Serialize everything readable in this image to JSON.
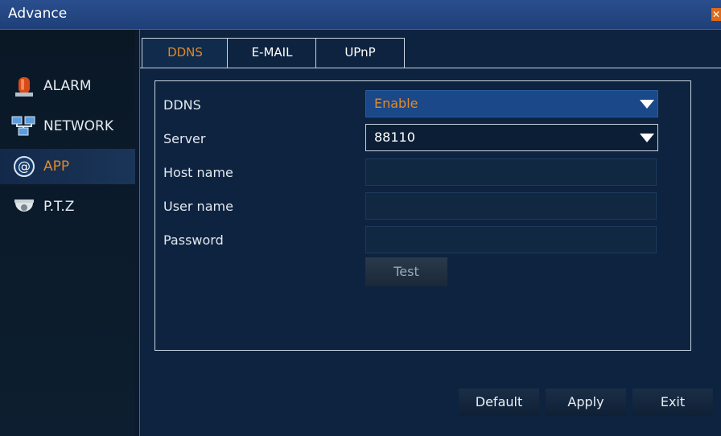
{
  "window": {
    "title": "Advance"
  },
  "sidebar": {
    "items": [
      {
        "label": "ALARM",
        "icon": "alarm-siren-icon"
      },
      {
        "label": "NETWORK",
        "icon": "network-icon"
      },
      {
        "label": "APP",
        "icon": "at-sign-icon",
        "active": true
      },
      {
        "label": "P.T.Z",
        "icon": "dome-camera-icon"
      }
    ]
  },
  "tabs": [
    {
      "label": "DDNS",
      "active": true
    },
    {
      "label": "E-MAIL"
    },
    {
      "label": "UPnP"
    }
  ],
  "form": {
    "ddns_label": "DDNS",
    "ddns_value": "Enable",
    "server_label": "Server",
    "server_value": "88110",
    "host_label": "Host name",
    "host_value": "",
    "user_label": "User name",
    "user_value": "",
    "password_label": "Password",
    "password_value": "",
    "test_label": "Test"
  },
  "footer": {
    "default_label": "Default",
    "apply_label": "Apply",
    "exit_label": "Exit"
  },
  "colors": {
    "accent": "#e0892a",
    "background": "#0d2340",
    "selected_field": "#1a4889"
  }
}
